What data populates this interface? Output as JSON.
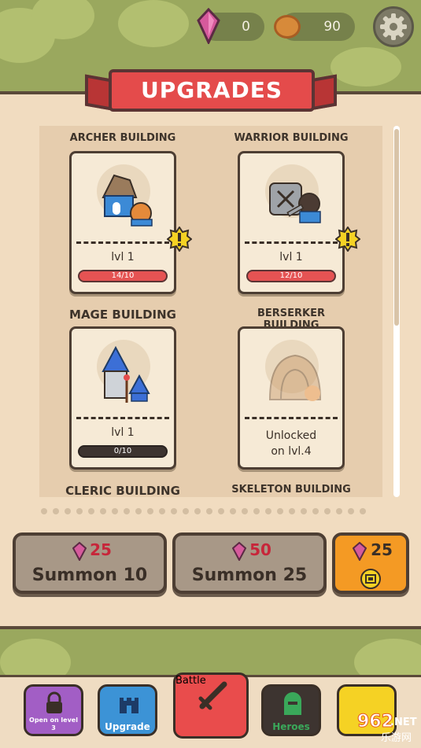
{
  "currency": {
    "gems": "0",
    "coins": "90"
  },
  "title": "UPGRADES",
  "buildings": [
    {
      "name": "ARCHER BUILDING",
      "level": "lvl 1",
      "progress_text": "14/10",
      "progress": 1.0,
      "upgrade_available": true
    },
    {
      "name": "WARRIOR BUILDING",
      "level": "lvl 1",
      "progress_text": "12/10",
      "progress": 1.0,
      "upgrade_available": true
    },
    {
      "name": "MAGE BUILDING",
      "level": "lvl 1",
      "progress_text": "0/10",
      "progress": 0.0,
      "upgrade_available": false
    },
    {
      "name": "BERSERKER BUILDING",
      "unlock_line1": "Unlocked",
      "unlock_line2": "on lvl.4",
      "locked": true
    },
    {
      "name": "CLERIC BUILDING"
    },
    {
      "name": "SKELETON BUILDING"
    }
  ],
  "summon": [
    {
      "cost": "25",
      "label": "Summon 10"
    },
    {
      "cost": "50",
      "label": "Summon 25"
    },
    {
      "cost": "25"
    }
  ],
  "nav": {
    "locked_label": "Open on level 3",
    "upgrade": "Upgrade",
    "battle": "Battle",
    "heroes": "Heroes"
  },
  "watermark": {
    "number": "962",
    "tld": ".NET",
    "cn": "乐游网"
  },
  "colors": {
    "banner": "#e44b4b",
    "panel": "#f1dcc0",
    "progress_full": "#e55353",
    "progress_empty": "#3d3430",
    "gem": "#d65a9c",
    "summon_special": "#f49a24",
    "nav_locked": "#a25ec5",
    "nav_upgrade": "#3c93d6",
    "nav_battle": "#e94c4c",
    "nav_heroes": "#3d3430"
  }
}
